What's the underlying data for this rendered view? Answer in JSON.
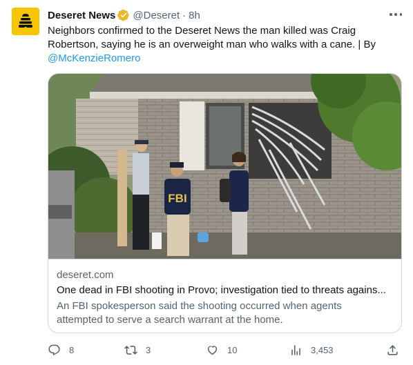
{
  "tweet": {
    "author_name": "Deseret News",
    "handle": "@Deseret",
    "separator": "·",
    "time": "8h",
    "text": "Neighbors confirmed to the Deseret News the man killed was Craig Robertson, saying he is an overweight man who walks with a cane. | By ",
    "mention": "@McKenzieRomero"
  },
  "card": {
    "photo_vest_text": "FBI",
    "domain": "deseret.com",
    "title": "One dead in FBI shooting in Provo; investigation tied to threats agains...",
    "description": "An FBI spokesperson said the shooting occurred when agents attempted to serve a search warrant at the home."
  },
  "actions": {
    "replies": "8",
    "retweets": "3",
    "likes": "10",
    "views": "3,453"
  },
  "colors": {
    "avatar_bg": "#f7c600",
    "verified_badge": "#e8b829",
    "link": "#1d9bf0",
    "secondary_text": "#536471",
    "border": "#cfd9de"
  },
  "icons": {
    "avatar": "beehive-logo",
    "verified": "verified-badge-icon",
    "more": "more-icon",
    "reply": "reply-icon",
    "retweet": "retweet-icon",
    "like": "heart-icon",
    "views": "views-chart-icon",
    "share": "share-icon"
  }
}
